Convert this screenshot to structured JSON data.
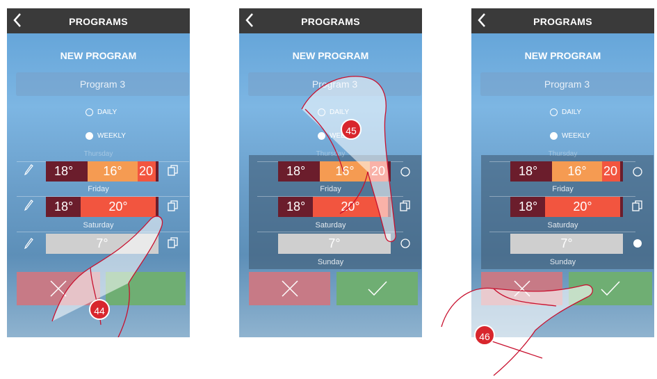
{
  "topbar": {
    "title": "PROGRAMS"
  },
  "form": {
    "subtitle": "NEW PROGRAM",
    "program_name": "Program 3",
    "mode_daily": "DAILY",
    "mode_weekly": "WEEKLY",
    "selected_mode": "weekly"
  },
  "days": {
    "thursday": "Thursday",
    "friday": "Friday",
    "saturday": "Saturday",
    "sunday": "Sunday"
  },
  "temps": {
    "thursday": [
      "18°",
      "16°",
      "20"
    ],
    "friday": [
      "18°",
      "20°"
    ],
    "saturday": [
      "7°"
    ]
  },
  "markers": {
    "step1": "44",
    "step2": "45",
    "step3": "46"
  },
  "colors": {
    "low": "#6b1d2c",
    "mid": "#f59b52",
    "high": "#f2553f",
    "off": "#cfcfcf",
    "cancel": "#c77a86",
    "confirm": "#6fae73",
    "marker": "#d8262d"
  },
  "icons": {
    "back": "chevron-left-icon",
    "edit": "pencil-icon",
    "copy": "copy-icon",
    "radio": "radio-icon",
    "cancel": "x-icon",
    "confirm": "checkmark-icon",
    "hand": "hand-pointer-icon"
  }
}
